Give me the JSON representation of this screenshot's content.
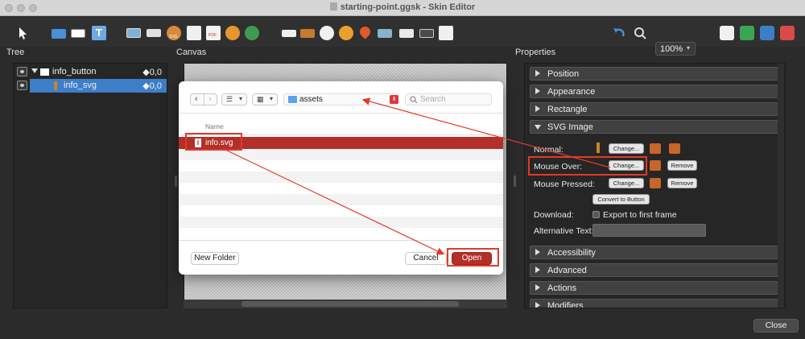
{
  "window": {
    "title": "starting-point.ggsk - Skin Editor"
  },
  "toolbar": {
    "zoom": "100%",
    "icon_small_labels": {
      "svg": "SVG",
      "pdf": "PDF"
    }
  },
  "panels": {
    "tree": "Tree",
    "canvas": "Canvas",
    "properties": "Properties"
  },
  "tree": {
    "items": [
      {
        "label": "info_button",
        "pos": "◆0,0"
      },
      {
        "label": "info_svg",
        "pos": "◆0,0"
      }
    ]
  },
  "dialog": {
    "location": "assets",
    "search_placeholder": "Search",
    "column_name": "Name",
    "selected_file": "info.svg",
    "new_folder": "New Folder",
    "cancel": "Cancel",
    "open": "Open"
  },
  "properties": {
    "sections": {
      "position": "Position",
      "appearance": "Appearance",
      "rectangle": "Rectangle",
      "svg_image": "SVG Image",
      "accessibility": "Accessibility",
      "advanced": "Advanced",
      "actions": "Actions",
      "modifiers": "Modifiers"
    },
    "normal": "Normal:",
    "mouse_over": "Mouse Over:",
    "mouse_pressed": "Mouse Pressed:",
    "change": "Change...",
    "remove": "Remove",
    "convert": "Convert to Button",
    "download": "Download:",
    "export_first_frame": "Export to first frame",
    "alt_text": "Alternative Text:"
  },
  "footer": {
    "close": "Close"
  },
  "colors": {
    "accent_red": "#b22f2a",
    "annotation_red": "#e23a2a",
    "selection_blue": "#3d7ec9"
  }
}
